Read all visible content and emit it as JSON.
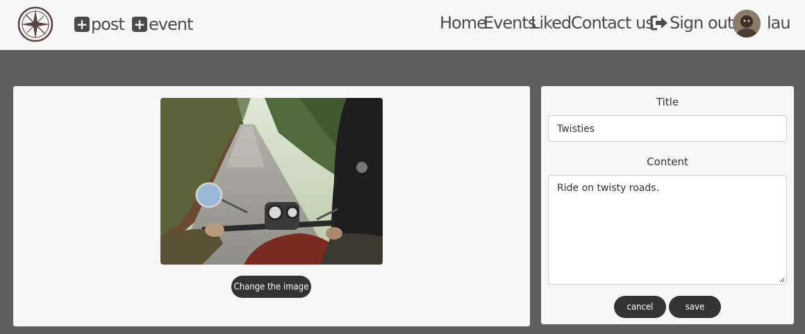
{
  "nav": {
    "add_post": "post",
    "add_event": "event",
    "links": [
      "Home",
      "Events",
      "Liked",
      "Contact us"
    ],
    "sign_out": "Sign out",
    "username": "lau"
  },
  "editor": {
    "change_image_label": "Change the image",
    "title_label": "Title",
    "title_value": "Twisties",
    "content_label": "Content",
    "content_value": "Ride on twisty roads.",
    "cancel_label": "cancel",
    "save_label": "save"
  },
  "colors": {
    "navbar_bg": "#f7f7f7",
    "page_bg": "#5f5f5f",
    "button_bg": "#333333",
    "text": "#4a4a4a"
  },
  "icons": {
    "logo": "compass-logo",
    "add": "plus-square-icon",
    "sign_out": "sign-out-icon"
  }
}
